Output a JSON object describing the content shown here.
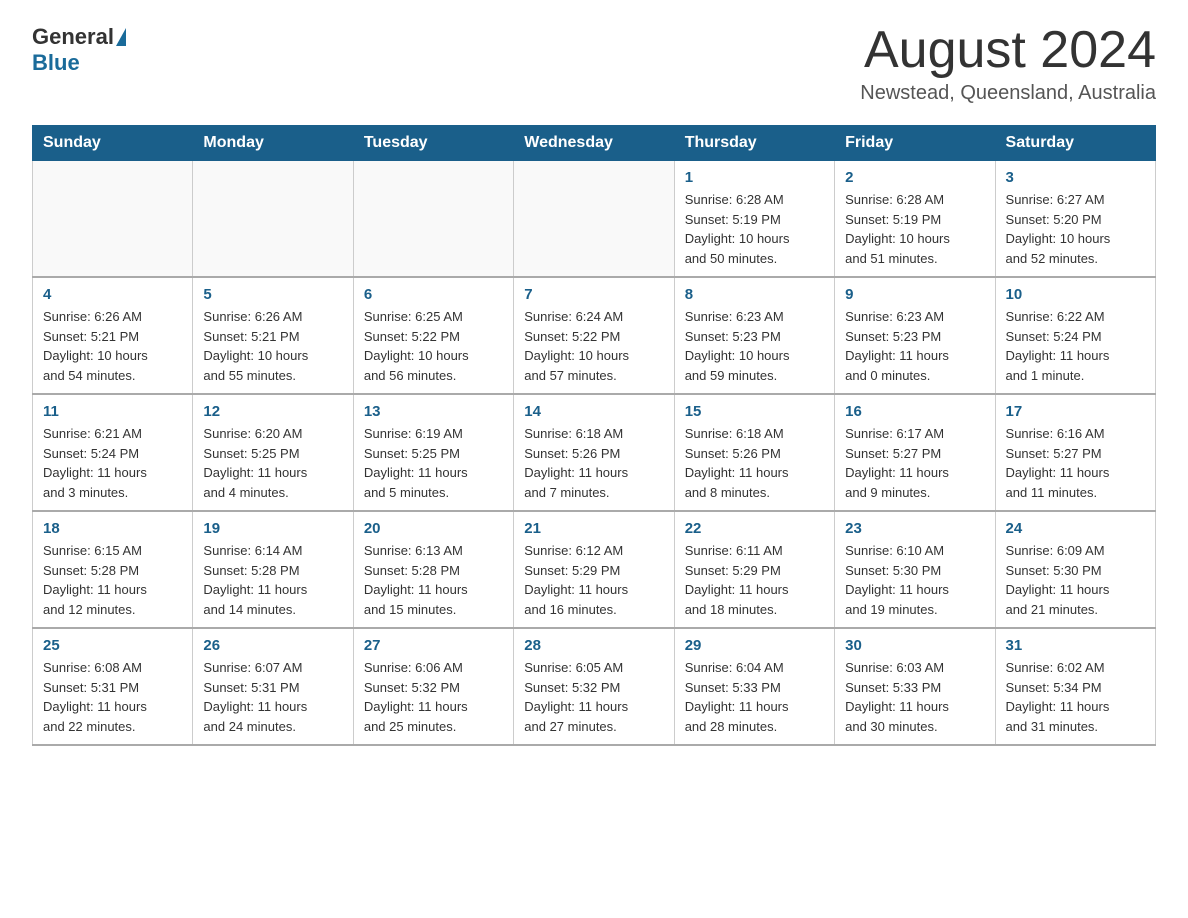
{
  "header": {
    "logo_general": "General",
    "logo_blue": "Blue",
    "month_title": "August 2024",
    "location": "Newstead, Queensland, Australia"
  },
  "weekdays": [
    "Sunday",
    "Monday",
    "Tuesday",
    "Wednesday",
    "Thursday",
    "Friday",
    "Saturday"
  ],
  "weeks": [
    [
      {
        "day": "",
        "info": ""
      },
      {
        "day": "",
        "info": ""
      },
      {
        "day": "",
        "info": ""
      },
      {
        "day": "",
        "info": ""
      },
      {
        "day": "1",
        "info": "Sunrise: 6:28 AM\nSunset: 5:19 PM\nDaylight: 10 hours\nand 50 minutes."
      },
      {
        "day": "2",
        "info": "Sunrise: 6:28 AM\nSunset: 5:19 PM\nDaylight: 10 hours\nand 51 minutes."
      },
      {
        "day": "3",
        "info": "Sunrise: 6:27 AM\nSunset: 5:20 PM\nDaylight: 10 hours\nand 52 minutes."
      }
    ],
    [
      {
        "day": "4",
        "info": "Sunrise: 6:26 AM\nSunset: 5:21 PM\nDaylight: 10 hours\nand 54 minutes."
      },
      {
        "day": "5",
        "info": "Sunrise: 6:26 AM\nSunset: 5:21 PM\nDaylight: 10 hours\nand 55 minutes."
      },
      {
        "day": "6",
        "info": "Sunrise: 6:25 AM\nSunset: 5:22 PM\nDaylight: 10 hours\nand 56 minutes."
      },
      {
        "day": "7",
        "info": "Sunrise: 6:24 AM\nSunset: 5:22 PM\nDaylight: 10 hours\nand 57 minutes."
      },
      {
        "day": "8",
        "info": "Sunrise: 6:23 AM\nSunset: 5:23 PM\nDaylight: 10 hours\nand 59 minutes."
      },
      {
        "day": "9",
        "info": "Sunrise: 6:23 AM\nSunset: 5:23 PM\nDaylight: 11 hours\nand 0 minutes."
      },
      {
        "day": "10",
        "info": "Sunrise: 6:22 AM\nSunset: 5:24 PM\nDaylight: 11 hours\nand 1 minute."
      }
    ],
    [
      {
        "day": "11",
        "info": "Sunrise: 6:21 AM\nSunset: 5:24 PM\nDaylight: 11 hours\nand 3 minutes."
      },
      {
        "day": "12",
        "info": "Sunrise: 6:20 AM\nSunset: 5:25 PM\nDaylight: 11 hours\nand 4 minutes."
      },
      {
        "day": "13",
        "info": "Sunrise: 6:19 AM\nSunset: 5:25 PM\nDaylight: 11 hours\nand 5 minutes."
      },
      {
        "day": "14",
        "info": "Sunrise: 6:18 AM\nSunset: 5:26 PM\nDaylight: 11 hours\nand 7 minutes."
      },
      {
        "day": "15",
        "info": "Sunrise: 6:18 AM\nSunset: 5:26 PM\nDaylight: 11 hours\nand 8 minutes."
      },
      {
        "day": "16",
        "info": "Sunrise: 6:17 AM\nSunset: 5:27 PM\nDaylight: 11 hours\nand 9 minutes."
      },
      {
        "day": "17",
        "info": "Sunrise: 6:16 AM\nSunset: 5:27 PM\nDaylight: 11 hours\nand 11 minutes."
      }
    ],
    [
      {
        "day": "18",
        "info": "Sunrise: 6:15 AM\nSunset: 5:28 PM\nDaylight: 11 hours\nand 12 minutes."
      },
      {
        "day": "19",
        "info": "Sunrise: 6:14 AM\nSunset: 5:28 PM\nDaylight: 11 hours\nand 14 minutes."
      },
      {
        "day": "20",
        "info": "Sunrise: 6:13 AM\nSunset: 5:28 PM\nDaylight: 11 hours\nand 15 minutes."
      },
      {
        "day": "21",
        "info": "Sunrise: 6:12 AM\nSunset: 5:29 PM\nDaylight: 11 hours\nand 16 minutes."
      },
      {
        "day": "22",
        "info": "Sunrise: 6:11 AM\nSunset: 5:29 PM\nDaylight: 11 hours\nand 18 minutes."
      },
      {
        "day": "23",
        "info": "Sunrise: 6:10 AM\nSunset: 5:30 PM\nDaylight: 11 hours\nand 19 minutes."
      },
      {
        "day": "24",
        "info": "Sunrise: 6:09 AM\nSunset: 5:30 PM\nDaylight: 11 hours\nand 21 minutes."
      }
    ],
    [
      {
        "day": "25",
        "info": "Sunrise: 6:08 AM\nSunset: 5:31 PM\nDaylight: 11 hours\nand 22 minutes."
      },
      {
        "day": "26",
        "info": "Sunrise: 6:07 AM\nSunset: 5:31 PM\nDaylight: 11 hours\nand 24 minutes."
      },
      {
        "day": "27",
        "info": "Sunrise: 6:06 AM\nSunset: 5:32 PM\nDaylight: 11 hours\nand 25 minutes."
      },
      {
        "day": "28",
        "info": "Sunrise: 6:05 AM\nSunset: 5:32 PM\nDaylight: 11 hours\nand 27 minutes."
      },
      {
        "day": "29",
        "info": "Sunrise: 6:04 AM\nSunset: 5:33 PM\nDaylight: 11 hours\nand 28 minutes."
      },
      {
        "day": "30",
        "info": "Sunrise: 6:03 AM\nSunset: 5:33 PM\nDaylight: 11 hours\nand 30 minutes."
      },
      {
        "day": "31",
        "info": "Sunrise: 6:02 AM\nSunset: 5:34 PM\nDaylight: 11 hours\nand 31 minutes."
      }
    ]
  ]
}
